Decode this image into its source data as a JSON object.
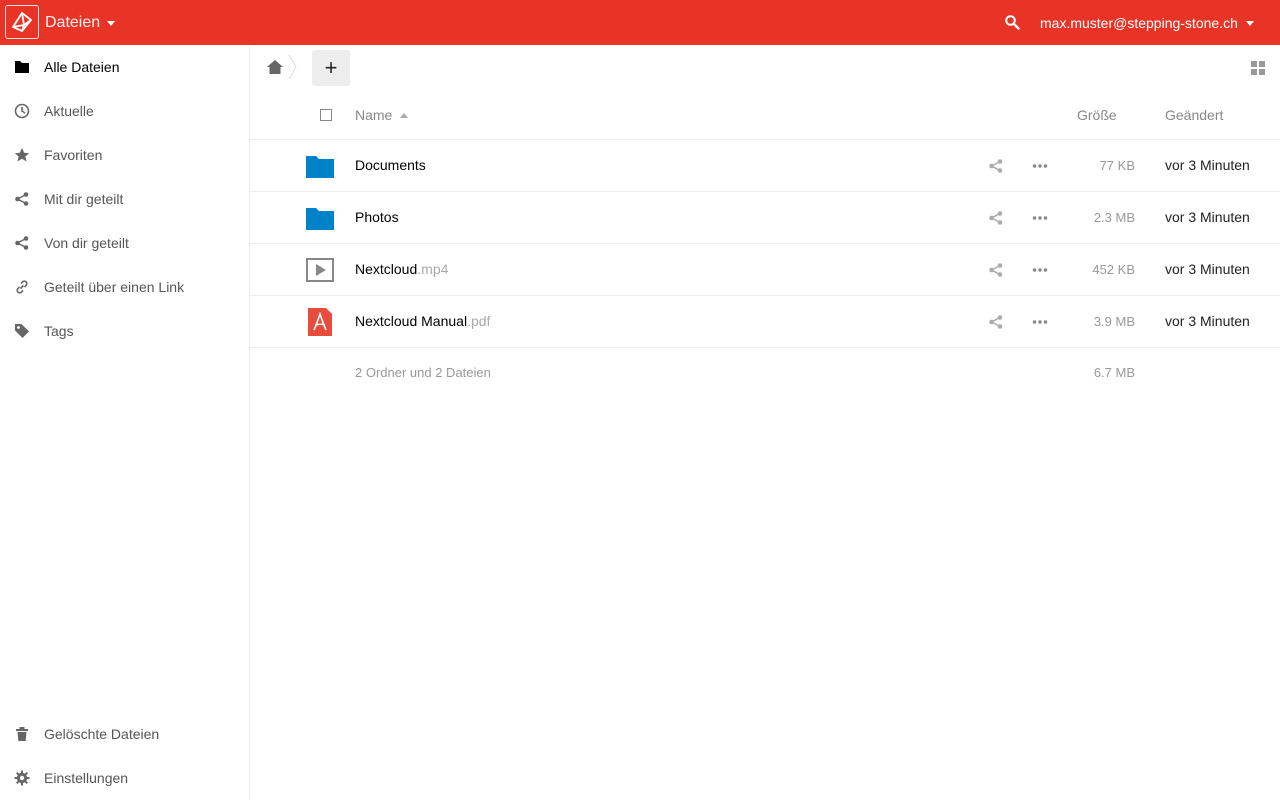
{
  "colors": {
    "brand": "#e73427",
    "folder": "#0082c9",
    "pdf": "#e74c3c"
  },
  "header": {
    "app_name": "Dateien",
    "user": "max.muster@stepping-stone.ch"
  },
  "sidebar": {
    "items": [
      {
        "label": "Alle Dateien",
        "icon": "folder-icon"
      },
      {
        "label": "Aktuelle",
        "icon": "clock-icon"
      },
      {
        "label": "Favoriten",
        "icon": "star-icon"
      },
      {
        "label": "Mit dir geteilt",
        "icon": "share-icon"
      },
      {
        "label": "Von dir geteilt",
        "icon": "share-icon"
      },
      {
        "label": "Geteilt über einen Link",
        "icon": "link-icon"
      },
      {
        "label": "Tags",
        "icon": "tag-icon"
      }
    ],
    "bottom": [
      {
        "label": "Gelöschte Dateien",
        "icon": "trash-icon"
      },
      {
        "label": "Einstellungen",
        "icon": "gear-icon"
      }
    ]
  },
  "toolbar": {
    "new_label": "+"
  },
  "table": {
    "columns": {
      "name": "Name",
      "size": "Größe",
      "modified": "Geändert"
    },
    "rows": [
      {
        "name": "Documents",
        "ext": "",
        "type": "folder",
        "size": "77 KB",
        "modified": "vor 3 Minuten"
      },
      {
        "name": "Photos",
        "ext": "",
        "type": "folder",
        "size": "2.3 MB",
        "modified": "vor 3 Minuten"
      },
      {
        "name": "Nextcloud",
        "ext": ".mp4",
        "type": "video",
        "size": "452 KB",
        "modified": "vor 3 Minuten"
      },
      {
        "name": "Nextcloud Manual",
        "ext": ".pdf",
        "type": "pdf",
        "size": "3.9 MB",
        "modified": "vor 3 Minuten"
      }
    ],
    "summary": {
      "text": "2 Ordner und 2 Dateien",
      "size": "6.7 MB"
    }
  }
}
